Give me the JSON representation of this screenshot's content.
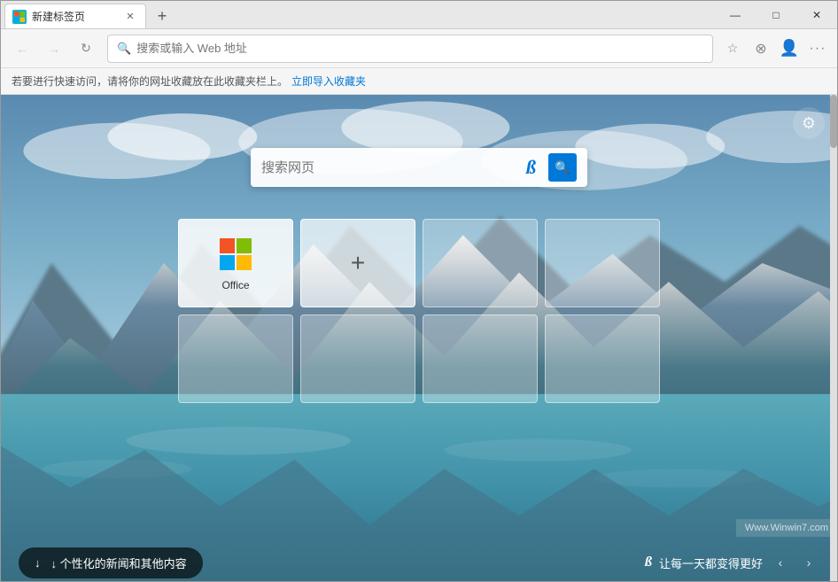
{
  "window": {
    "title": "新建标签页",
    "controls": {
      "minimize": "—",
      "maximize": "□",
      "close": "✕"
    }
  },
  "tab": {
    "title": "新建标签页",
    "icon_label": "E"
  },
  "new_tab_button": "+",
  "navbar": {
    "back_disabled": true,
    "forward_disabled": true,
    "refresh_label": "↻",
    "address_placeholder": "搜索或输入 Web 地址",
    "favorite_icon": "☆",
    "hub_icon": "☆",
    "profile_icon": "○",
    "more_icon": "···"
  },
  "bookmarkbar": {
    "message": "若要进行快速访问，请将你的网址收藏放在此收藏夹栏上。",
    "import_link": "立即导入收藏夹"
  },
  "main": {
    "settings_icon": "⚙",
    "search": {
      "placeholder": "搜索网页",
      "bing_label": "b",
      "search_icon": "🔍"
    },
    "speed_dial": [
      {
        "id": "office",
        "label": "Office",
        "type": "office"
      },
      {
        "id": "add",
        "label": "",
        "type": "add"
      },
      {
        "id": "empty1",
        "label": "",
        "type": "empty"
      },
      {
        "id": "empty2",
        "label": "",
        "type": "empty"
      },
      {
        "id": "empty3",
        "label": "",
        "type": "empty"
      },
      {
        "id": "empty4",
        "label": "",
        "type": "empty"
      },
      {
        "id": "empty5",
        "label": "",
        "type": "empty"
      },
      {
        "id": "empty6",
        "label": "",
        "type": "empty"
      }
    ],
    "bottom_bar": {
      "news_button": "↓  个性化的新闻和其他内容",
      "bing_text": "b",
      "tagline": "让每一天都变得更好",
      "prev_arrow": "‹",
      "next_arrow": "›"
    },
    "watermark": {
      "logo_text": "Win7",
      "site": "Winwin7.com"
    }
  },
  "colors": {
    "accent": "#0078d7",
    "tab_bg": "#ffffff",
    "titlebar_bg": "#e8e8e8",
    "navbar_bg": "#f5f5f5"
  }
}
